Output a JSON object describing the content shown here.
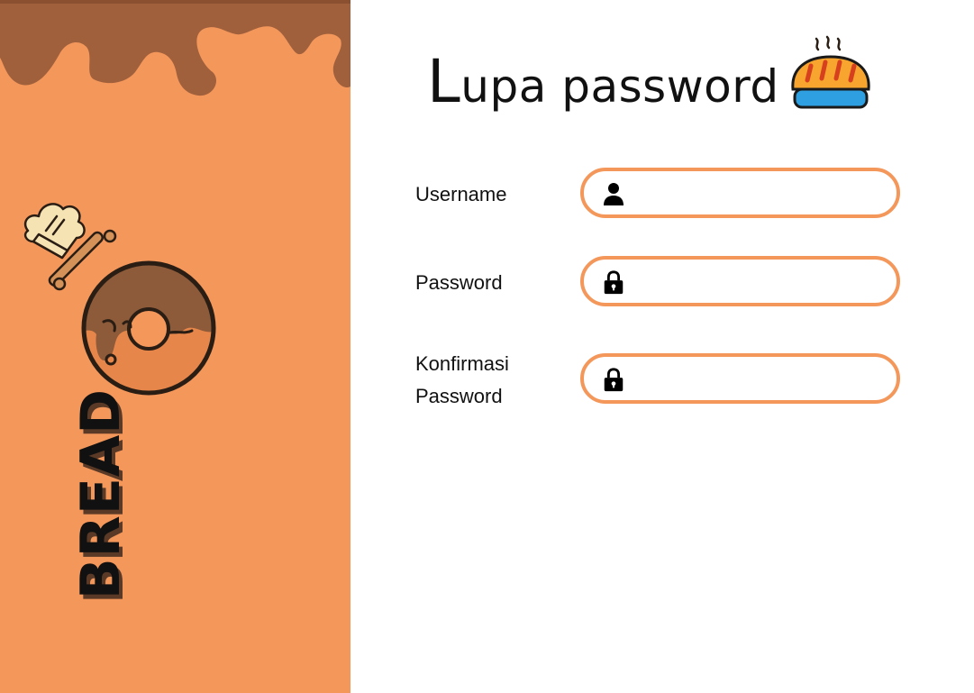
{
  "page": {
    "title_initial": "L",
    "title_rest": "upa password"
  },
  "brand": {
    "name": "BREAD"
  },
  "form": {
    "username": {
      "label": "Username",
      "value": "",
      "icon": "user-icon"
    },
    "password": {
      "label": "Password",
      "value": "",
      "icon": "lock-icon"
    },
    "confirm_password": {
      "label_line1": "Konfirmasi",
      "label_line2": "Password",
      "value": "",
      "icon": "lock-icon"
    }
  },
  "colors": {
    "accent": "#f4975b",
    "chocolate": "#a0603c",
    "text": "#111111",
    "background": "#ffffff"
  }
}
